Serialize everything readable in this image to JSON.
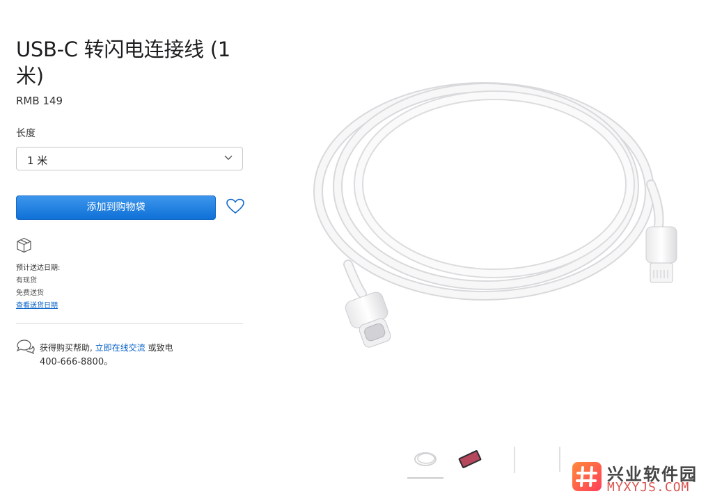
{
  "product": {
    "title": "USB-C 转闪电连接线 (1 米)",
    "price": "RMB 149"
  },
  "length": {
    "label": "长度",
    "selected": "1 米"
  },
  "actions": {
    "add_to_bag": "添加到购物袋"
  },
  "shipping": {
    "title": "预计送达日期:",
    "line1": "有现货",
    "line2": "免费送货",
    "link": "查看送货日期"
  },
  "help": {
    "prefix": "获得购买帮助,",
    "chat_link": "立即在线交流",
    "suffix": " 或致电",
    "phone": "400-666-8800。"
  },
  "gallery": {
    "thumbnails": [
      "cable-coil",
      "ipad",
      "cable-side",
      "cable-connector"
    ]
  },
  "watermark": {
    "text": "兴业软件园",
    "sub": "MYXYJS.COM"
  },
  "colors": {
    "button": "#0f70d6",
    "link": "#0a63c9"
  }
}
